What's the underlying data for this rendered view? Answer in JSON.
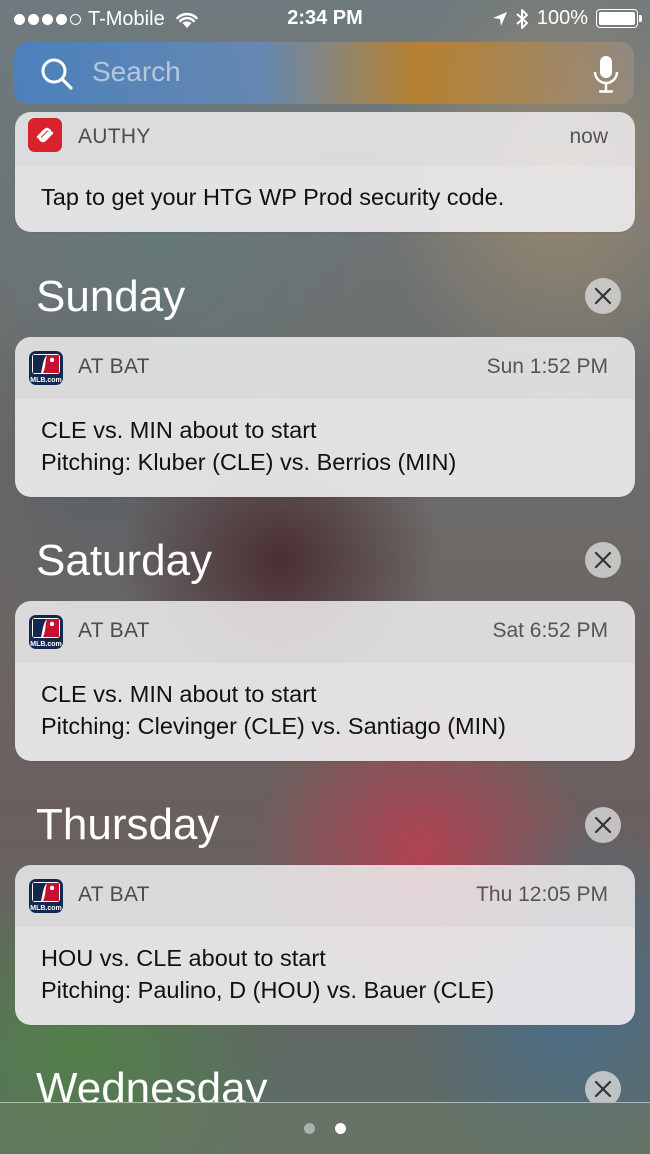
{
  "status_bar": {
    "carrier": "T-Mobile",
    "time": "2:34 PM",
    "battery": "100%",
    "battery_level": 1.0
  },
  "search": {
    "placeholder": "Search"
  },
  "notifications": [
    {
      "app": "AUTHY",
      "icon": "authy-icon",
      "time": "now",
      "lines": [
        "Tap to get your HTG WP Prod security code."
      ]
    }
  ],
  "sections": [
    {
      "heading": "Sunday",
      "notification": {
        "app": "AT BAT",
        "icon": "mlb-icon",
        "time": "Sun 1:52 PM",
        "lines": [
          "CLE vs. MIN about to start",
          "Pitching: Kluber (CLE) vs. Berrios (MIN)"
        ]
      }
    },
    {
      "heading": "Saturday",
      "notification": {
        "app": "AT BAT",
        "icon": "mlb-icon",
        "time": "Sat 6:52 PM",
        "lines": [
          "CLE vs. MIN about to start",
          "Pitching: Clevinger (CLE) vs. Santiago (MIN)"
        ]
      }
    },
    {
      "heading": "Thursday",
      "notification": {
        "app": "AT BAT",
        "icon": "mlb-icon",
        "time": "Thu 12:05 PM",
        "lines": [
          "HOU vs. CLE about to start",
          "Pitching: Paulino, D (HOU) vs. Bauer (CLE)"
        ]
      }
    },
    {
      "heading": "Wednesday"
    }
  ],
  "mlb_logo_text": "MLB.com",
  "page_indicator": {
    "count": 2,
    "current": 2
  },
  "colors": {
    "authy_red": "#d8222c",
    "mlb_navy": "#13274f",
    "mlb_red": "#c8102e"
  }
}
